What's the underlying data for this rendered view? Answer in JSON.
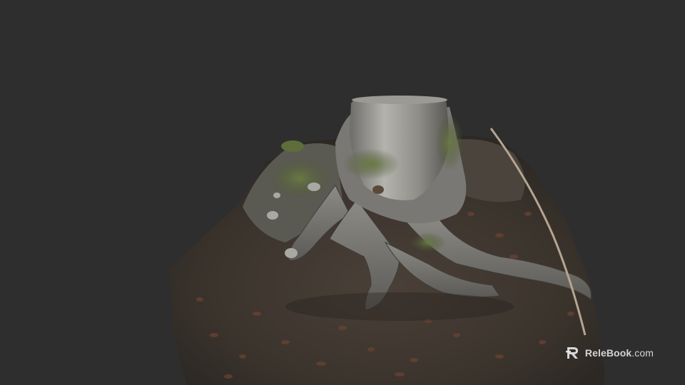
{
  "scene": {
    "subject": "tree-stump-3d-scan",
    "background_color": "#2e2e2e",
    "colors": {
      "ground": "#3a332c",
      "bark": "#8a8884",
      "bark_light": "#b9b8b3",
      "moss": "#5a6a3a",
      "leaf_litter": "#6a4232"
    }
  },
  "watermark": {
    "brand": "ReleBook",
    "tld": ".com",
    "logo_icon": "relebook-r-logo-icon"
  }
}
